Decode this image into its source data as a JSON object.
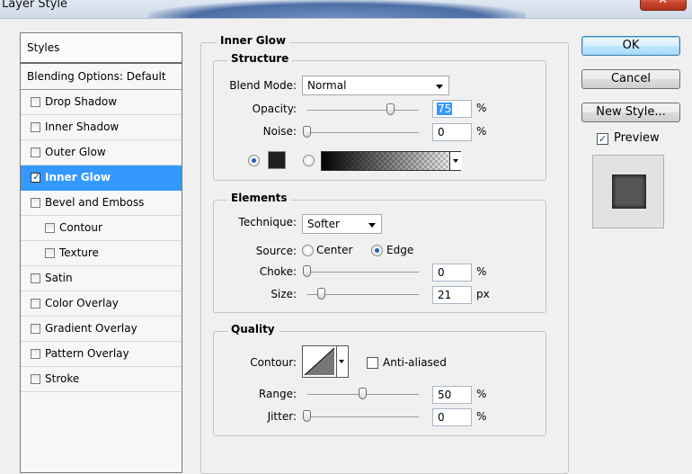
{
  "window": {
    "title": "Layer Style",
    "close_label": "✕"
  },
  "styles_panel": {
    "header": "Styles",
    "blending_options": "Blending Options: Default",
    "items": [
      {
        "label": "Drop Shadow",
        "checked": false,
        "selected": false,
        "indent": false
      },
      {
        "label": "Inner Shadow",
        "checked": false,
        "selected": false,
        "indent": false
      },
      {
        "label": "Outer Glow",
        "checked": false,
        "selected": false,
        "indent": false
      },
      {
        "label": "Inner Glow",
        "checked": true,
        "selected": true,
        "indent": false
      },
      {
        "label": "Bevel and Emboss",
        "checked": false,
        "selected": false,
        "indent": false
      },
      {
        "label": "Contour",
        "checked": false,
        "selected": false,
        "indent": true
      },
      {
        "label": "Texture",
        "checked": false,
        "selected": false,
        "indent": true
      },
      {
        "label": "Satin",
        "checked": false,
        "selected": false,
        "indent": false
      },
      {
        "label": "Color Overlay",
        "checked": false,
        "selected": false,
        "indent": false
      },
      {
        "label": "Gradient Overlay",
        "checked": false,
        "selected": false,
        "indent": false
      },
      {
        "label": "Pattern Overlay",
        "checked": false,
        "selected": false,
        "indent": false
      },
      {
        "label": "Stroke",
        "checked": false,
        "selected": false,
        "indent": false
      }
    ]
  },
  "inner_glow": {
    "title": "Inner Glow",
    "structure": {
      "title": "Structure",
      "blend_mode_label": "Blend Mode:",
      "blend_mode_value": "Normal",
      "opacity_label": "Opacity:",
      "opacity_value": "75",
      "opacity_unit": "%",
      "noise_label": "Noise:",
      "noise_value": "0",
      "noise_unit": "%",
      "color_mode": "solid",
      "color": "#1e1e1e"
    },
    "elements": {
      "title": "Elements",
      "technique_label": "Technique:",
      "technique_value": "Softer",
      "source_label": "Source:",
      "source_center": "Center",
      "source_edge": "Edge",
      "source_selected": "Edge",
      "choke_label": "Choke:",
      "choke_value": "0",
      "choke_unit": "%",
      "size_label": "Size:",
      "size_value": "21",
      "size_unit": "px"
    },
    "quality": {
      "title": "Quality",
      "contour_label": "Contour:",
      "anti_aliased_label": "Anti-aliased",
      "anti_aliased": false,
      "range_label": "Range:",
      "range_value": "50",
      "range_unit": "%",
      "jitter_label": "Jitter:",
      "jitter_value": "0",
      "jitter_unit": "%"
    }
  },
  "buttons": {
    "ok": "OK",
    "cancel": "Cancel",
    "new_style": "New Style..."
  },
  "preview": {
    "label": "Preview",
    "checked": true
  }
}
